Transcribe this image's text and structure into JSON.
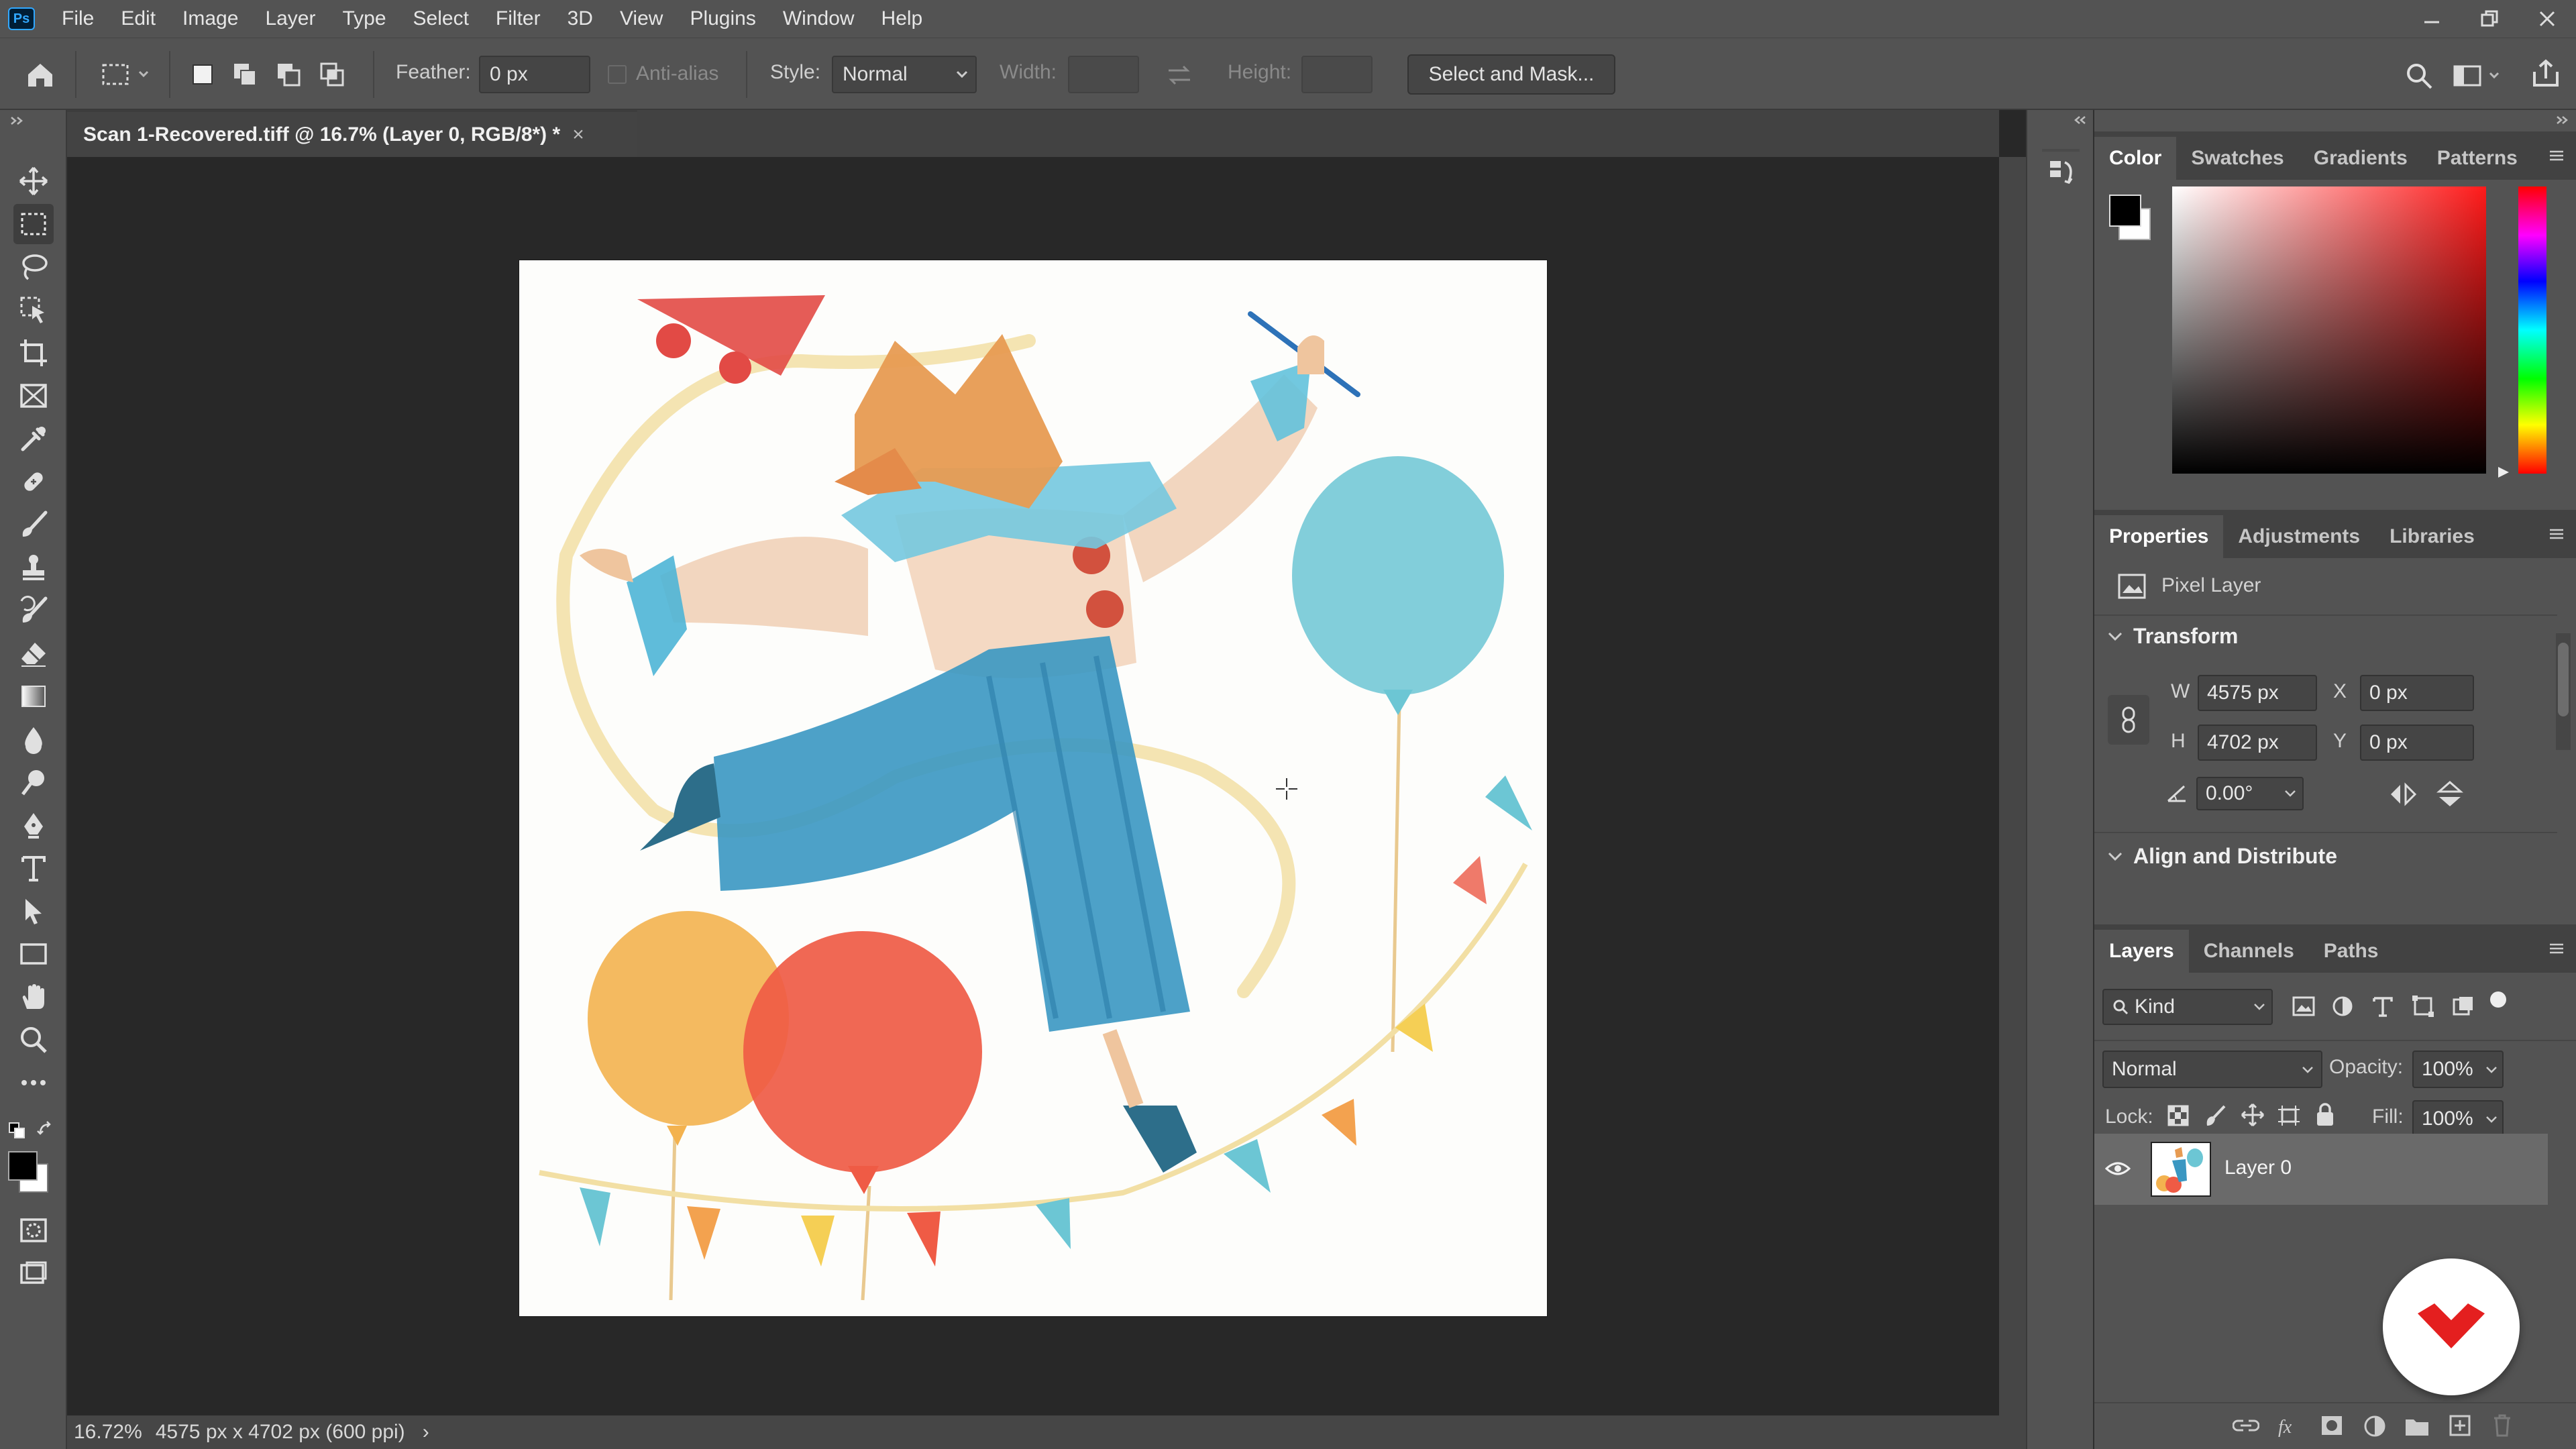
{
  "app": {
    "logo_text": "Ps"
  },
  "menu": [
    "File",
    "Edit",
    "Image",
    "Layer",
    "Type",
    "Select",
    "Filter",
    "3D",
    "View",
    "Plugins",
    "Window",
    "Help"
  ],
  "window_controls": {
    "minimize": "minimize-icon",
    "restore": "restore-icon",
    "close": "close-icon"
  },
  "options_bar": {
    "feather_label": "Feather:",
    "feather_value": "0 px",
    "antialias_label": "Anti-alias",
    "style_label": "Style:",
    "style_value": "Normal",
    "width_label": "Width:",
    "height_label": "Height:",
    "select_mask_button": "Select and Mask..."
  },
  "document": {
    "tab_title": "Scan 1-Recovered.tiff @ 16.7% (Layer 0, RGB/8*) *",
    "close_glyph": "×"
  },
  "status_bar": {
    "zoom": "16.72%",
    "info": "4575 px x 4702 px (600 ppi)",
    "arrow": "›"
  },
  "color_panel": {
    "tabs": [
      "Color",
      "Swatches",
      "Gradients",
      "Patterns"
    ],
    "active_tab": "Color",
    "foreground": "#000000",
    "background": "#ffffff",
    "hue_color": "#ff1a1a"
  },
  "properties_panel": {
    "tabs": [
      "Properties",
      "Adjustments",
      "Libraries"
    ],
    "active_tab": "Properties",
    "layer_kind": "Pixel Layer",
    "transform_title": "Transform",
    "w_label": "W",
    "w_value": "4575 px",
    "h_label": "H",
    "h_value": "4702 px",
    "x_label": "X",
    "x_value": "0 px",
    "y_label": "Y",
    "y_value": "0 px",
    "angle_value": "0.00°",
    "align_title": "Align and Distribute"
  },
  "layers_panel": {
    "tabs": [
      "Layers",
      "Channels",
      "Paths"
    ],
    "active_tab": "Layers",
    "filter_kind": "Kind",
    "blend_mode": "Normal",
    "opacity_label": "Opacity:",
    "opacity_value": "100%",
    "lock_label": "Lock:",
    "fill_label": "Fill:",
    "fill_value": "100%",
    "layers": [
      {
        "name": "Layer 0",
        "visible": true
      }
    ]
  }
}
